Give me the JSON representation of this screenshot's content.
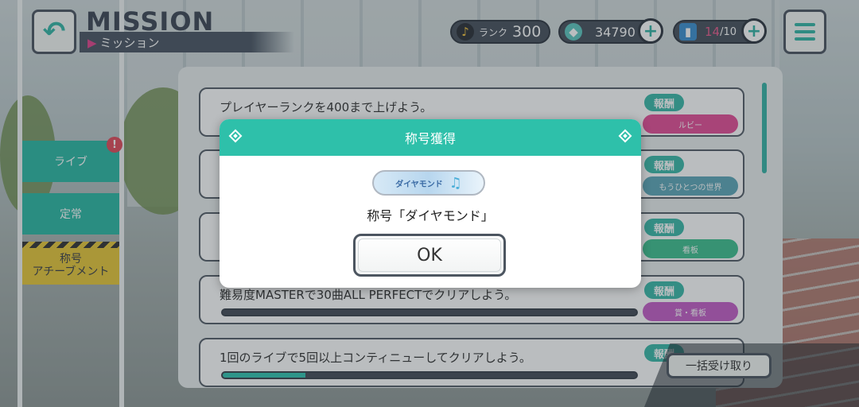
{
  "header": {
    "title": "MISSION",
    "subtitle": "ミッション"
  },
  "currencies": {
    "rank_label": "ランク",
    "rank_value": "300",
    "gems": "34790",
    "tickets_current": "14",
    "tickets_max": "/10"
  },
  "side_tabs": [
    {
      "label": "ライブ"
    },
    {
      "label": "定常"
    },
    {
      "label": "称号\nアチーブメント"
    }
  ],
  "missions": [
    {
      "text": "プレイヤーランクを400まで上げよう。",
      "reward_label": "報酬",
      "reward_item": "ルビー",
      "progress": 0.75
    },
    {
      "text": "",
      "reward_label": "報酬",
      "reward_item": "もうひとつの世界",
      "progress": 0.0
    },
    {
      "text": "",
      "reward_label": "報酬",
      "reward_item": "看板",
      "progress": 0.0
    },
    {
      "text": "難易度MASTERで30曲ALL PERFECTでクリアしよう。",
      "reward_label": "報酬",
      "reward_item": "賞・看板",
      "progress": 0.0
    },
    {
      "text": "1回のライブで5回以上コンティニューしてクリアしよう。",
      "reward_label": "報酬",
      "reward_item": "",
      "progress": 0.2
    }
  ],
  "claim_all": "一括受け取り",
  "modal": {
    "title": "称号獲得",
    "badge_text": "ダイヤモンド",
    "message": "称号「ダイヤモンド」",
    "ok": "OK"
  },
  "colors": {
    "accent": "#2ec0aa",
    "dark": "#4c5560",
    "alert": "#e24a5a",
    "tab_yellow": "#e8c739"
  }
}
